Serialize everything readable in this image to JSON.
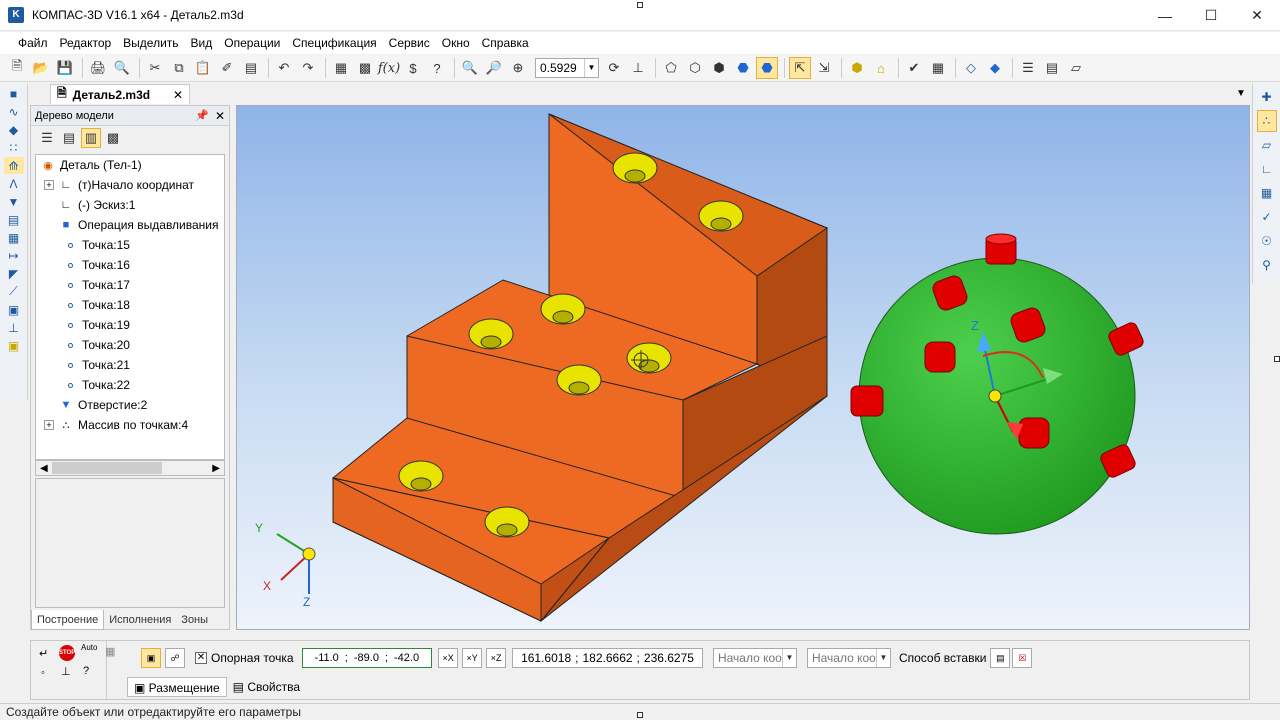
{
  "window": {
    "title": "КОМПАС-3D V16.1 x64 - Деталь2.m3d",
    "app_icon": "K"
  },
  "menu": [
    "Файл",
    "Редактор",
    "Выделить",
    "Вид",
    "Операции",
    "Спецификация",
    "Сервис",
    "Окно",
    "Справка"
  ],
  "toolbar": {
    "zoom_value": "0.5929"
  },
  "document_tab": {
    "label": "Деталь2.m3d"
  },
  "tree": {
    "header": "Дерево модели",
    "items": [
      {
        "label": "Деталь (Тел-1)",
        "level": 0,
        "icon": "part-icon"
      },
      {
        "label": "(т)Начало координат",
        "level": 1,
        "icon": "origin-icon",
        "expander": "+"
      },
      {
        "label": "(-) Эскиз:1",
        "level": 1,
        "icon": "sketch-icon"
      },
      {
        "label": "Операция выдавливания",
        "level": 1,
        "icon": "extrude-icon"
      },
      {
        "label": "Точка:15",
        "level": 1,
        "icon": "point-icon"
      },
      {
        "label": "Точка:16",
        "level": 1,
        "icon": "point-icon"
      },
      {
        "label": "Точка:17",
        "level": 1,
        "icon": "point-icon"
      },
      {
        "label": "Точка:18",
        "level": 1,
        "icon": "point-icon"
      },
      {
        "label": "Точка:19",
        "level": 1,
        "icon": "point-icon"
      },
      {
        "label": "Точка:20",
        "level": 1,
        "icon": "point-icon"
      },
      {
        "label": "Точка:21",
        "level": 1,
        "icon": "point-icon"
      },
      {
        "label": "Точка:22",
        "level": 1,
        "icon": "point-icon"
      },
      {
        "label": "Отверстие:2",
        "level": 1,
        "icon": "hole-icon"
      },
      {
        "label": "Массив по точкам:4",
        "level": 1,
        "icon": "pattern-icon",
        "expander": "+"
      }
    ],
    "tabs": [
      "Построение",
      "Исполнения",
      "Зоны"
    ]
  },
  "viewport": {
    "triad_labels": {
      "x": "X",
      "y": "Y",
      "z": "Z"
    },
    "sphere_axis_label": "Z",
    "colors": {
      "block": "#ee6a22",
      "hole": "#e8e400",
      "sphere": "#2fb52f",
      "pin": "#e10000"
    }
  },
  "properties": {
    "reference_point_label": "Опорная точка",
    "reference_coords": [
      "-11.0",
      "-89.0",
      "-42.0"
    ],
    "global_coords": [
      "161.6018",
      "182.6662",
      "236.6275"
    ],
    "origin_dropdown_1": "Начало коо",
    "origin_dropdown_2": "Начало коо",
    "insert_method_label": "Способ вставки",
    "tabs": [
      "Размещение",
      "Свойства"
    ],
    "stop_label": "STOP",
    "auto_label": "Auto"
  },
  "status": {
    "text": "Создайте объект или отредактируйте его параметры"
  }
}
